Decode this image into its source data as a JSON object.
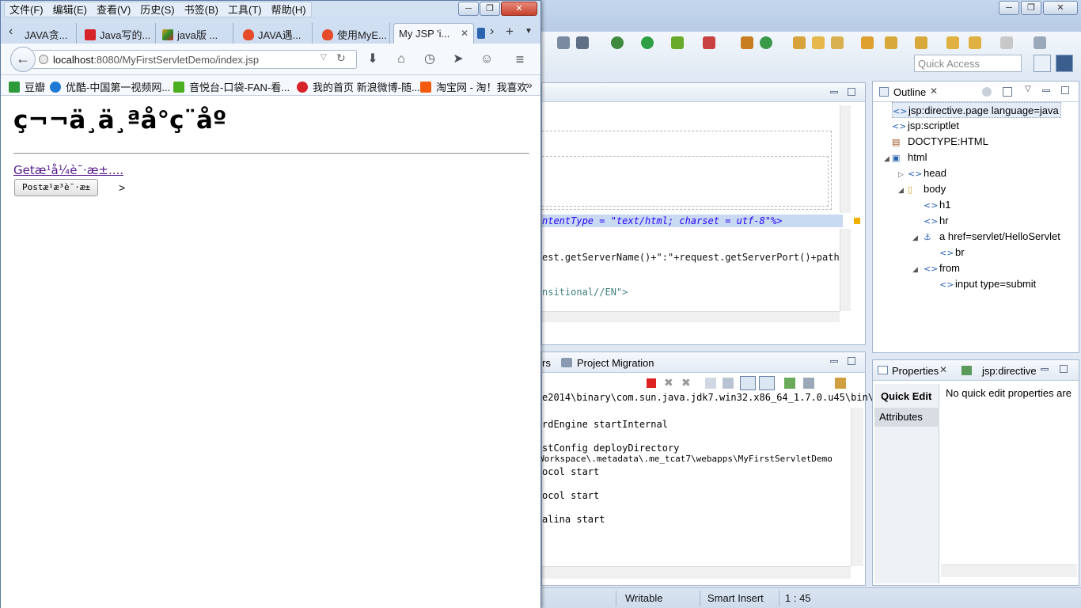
{
  "eclipse": {
    "quick_access_placeholder": "Quick Access",
    "editor_code": {
      "line1": "ntentType = \"text/html; charset = utf-8\"%>",
      "line2": "est.getServerName()+\":\"+request.getServerPort()+path+\"",
      "line3": "nsitional//EN\">"
    },
    "console": {
      "tabs": [
        "rs",
        "Project Migration"
      ],
      "lines": [
        "e2014\\binary\\com.sun.java.jdk7.win32.x86_64_1.7.0.u45\\bin\\javaw.exe (2",
        "rdEngine startInternal",
        "stConfig deployDirectory",
        "Workspace\\.metadata\\.me_tcat7\\webapps\\MyFirstServletDemo",
        "ocol start",
        "ocol start",
        "alina start"
      ]
    },
    "outline": {
      "title": "Outline",
      "items": [
        {
          "label": "jsp:directive.page language=java"
        },
        {
          "label": "jsp:scriptlet"
        },
        {
          "label": "DOCTYPE:HTML"
        },
        {
          "label": "html"
        },
        {
          "label": "head"
        },
        {
          "label": "body"
        },
        {
          "label": "h1"
        },
        {
          "label": "hr"
        },
        {
          "label": "a href=servlet/HelloServlet"
        },
        {
          "label": "br"
        },
        {
          "label": "from"
        },
        {
          "label": "input type=submit"
        }
      ]
    },
    "properties": {
      "tab1": "Properties",
      "tab2": "jsp:directive",
      "quick_edit": "Quick Edit",
      "attributes": "Attributes",
      "message": "No quick edit properties are"
    },
    "status": {
      "writable": "Writable",
      "insert_mode": "Smart Insert",
      "position": "1 : 45"
    }
  },
  "firefox": {
    "menu": [
      "文件(F)",
      "编辑(E)",
      "查看(V)",
      "历史(S)",
      "书签(B)",
      "工具(T)",
      "帮助(H)"
    ],
    "tabs": [
      {
        "label": "JAVA贪...",
        "color": "#e8e8e8"
      },
      {
        "label": "Java写的...",
        "color": "#d6242a"
      },
      {
        "label": "java版 ...",
        "color": "#e0a020"
      },
      {
        "label": "JAVA遇...",
        "color": "#e54b2b"
      },
      {
        "label": "使用MyE...",
        "color": "#e54b2b"
      },
      {
        "label": "My JSP 'i...",
        "color": "#ffffff"
      }
    ],
    "url": {
      "host": "localhost",
      "rest": ":8080/MyFirstServletDemo/index.jsp"
    },
    "bookmarks": [
      {
        "label": "豆瓣",
        "color": "#2f9a3a"
      },
      {
        "label": "优酷-中国第一视频网...",
        "color": "#1f7ad6"
      },
      {
        "label": "音悦台-口袋-FAN-看...",
        "color": "#4caf1e"
      },
      {
        "label": "我的首页 新浪微博-随...",
        "color": "#d6242a"
      },
      {
        "label": "淘宝网 - 淘！我喜欢",
        "color": "#f25b0e"
      }
    ],
    "page": {
      "heading": "ç¬¬ä¸ä¸ªå°ç¨åº",
      "link_text": "Getæ¹å¼è¯·æ±....",
      "submit_label": "Postæ¹æ³è¯·æ±",
      "trailing": ">"
    }
  }
}
